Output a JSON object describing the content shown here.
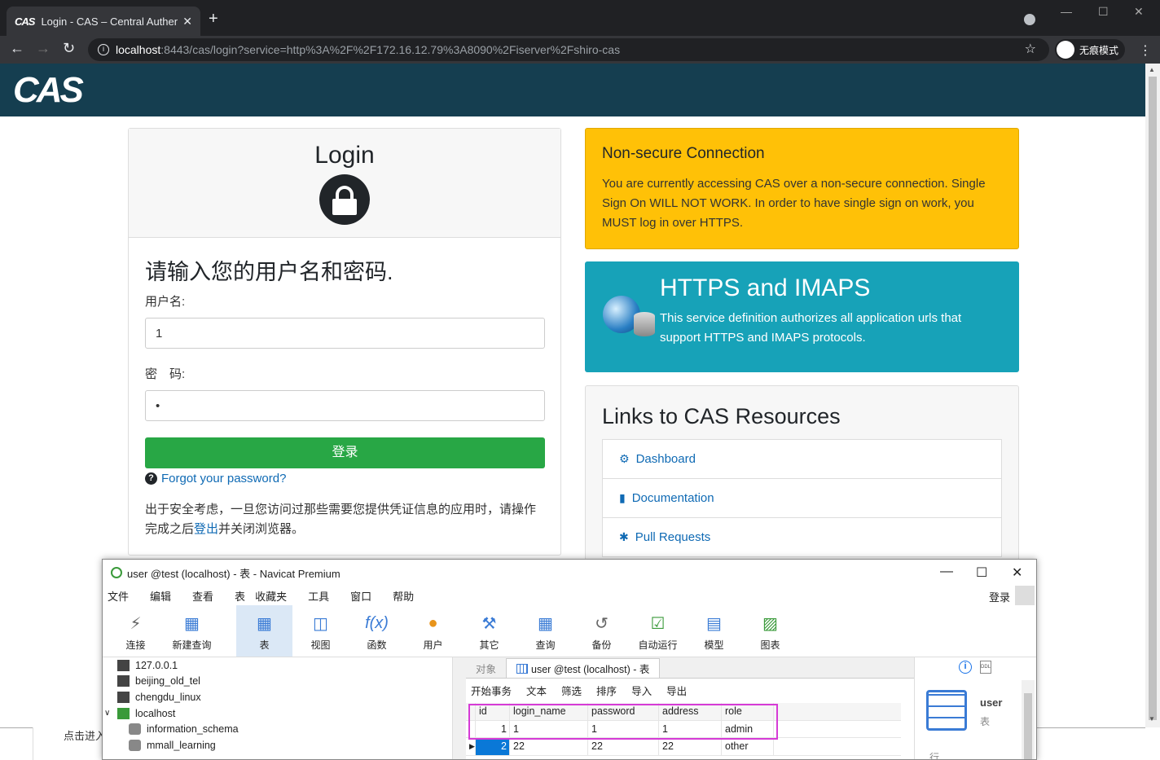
{
  "browser": {
    "tab_title": "Login - CAS – Central Authenti",
    "tab_favicon": "CAS",
    "url_host": "localhost",
    "url_rest": ":8443/cas/login?service=http%3A%2F%2F172.16.12.79%3A8090%2Fiserver%2Fshiro-cas",
    "incognito_label": "无痕模式"
  },
  "cas": {
    "logo": "CAS",
    "login": {
      "title": "Login",
      "heading": "请输入您的用户名和密码.",
      "username_label": "用户名:",
      "username_value": "1",
      "password_label": "密　码:",
      "password_value": "•",
      "submit_label": "登录",
      "forgot_label": "Forgot your password?",
      "notice_pre": "出于安全考虑，一旦您访问过那些需要您提供凭证信息的应用时，请操作完成之后",
      "notice_link": "登出",
      "notice_post": "并关闭浏览器。"
    },
    "warning": {
      "title": "Non-secure Connection",
      "body": "You are currently accessing CAS over a non-secure connection. Single Sign On WILL NOT WORK. In order to have single sign on work, you MUST log in over HTTPS."
    },
    "https_box": {
      "title": "HTTPS and IMAPS",
      "body": "This service definition authorizes all application urls that support HTTPS and IMAPS protocols."
    },
    "links": {
      "title": "Links to CAS Resources",
      "items": [
        {
          "label": "Dashboard",
          "icon": "cogs-icon"
        },
        {
          "label": "Documentation",
          "icon": "file-icon"
        },
        {
          "label": "Pull Requests",
          "icon": "bug-icon"
        }
      ]
    },
    "below_text": "点击进入"
  },
  "navicat": {
    "title": "user @test (localhost) - 表 - Navicat Premium",
    "menu": [
      "文件",
      "编辑",
      "查看",
      "表",
      "收藏夹",
      "工具",
      "窗口",
      "帮助"
    ],
    "login_label": "登录",
    "toolbar": [
      {
        "label": "连接",
        "icon": "plug-icon"
      },
      {
        "label": "新建查询",
        "icon": "new-query-icon"
      },
      {
        "label": "表",
        "icon": "table-icon"
      },
      {
        "label": "视图",
        "icon": "view-icon"
      },
      {
        "label": "函数",
        "icon": "function-icon"
      },
      {
        "label": "用户",
        "icon": "user-icon"
      },
      {
        "label": "其它",
        "icon": "tools-icon"
      },
      {
        "label": "查询",
        "icon": "query-icon"
      },
      {
        "label": "备份",
        "icon": "backup-icon"
      },
      {
        "label": "自动运行",
        "icon": "schedule-icon"
      },
      {
        "label": "模型",
        "icon": "model-icon"
      },
      {
        "label": "图表",
        "icon": "chart-icon"
      }
    ],
    "tree": [
      "127.0.0.1",
      "beijing_old_tel",
      "chengdu_linux",
      "localhost",
      "information_schema",
      "mmall_learning"
    ],
    "tabs": {
      "objects": "对象",
      "active": "user @test (localhost) - 表"
    },
    "subtoolbar": [
      "开始事务",
      "文本",
      "筛选",
      "排序",
      "导入",
      "导出"
    ],
    "grid": {
      "columns": [
        "id",
        "login_name",
        "password",
        "address",
        "role"
      ],
      "rows": [
        {
          "rownum": "1",
          "id": "1",
          "login_name": "1",
          "password": "1",
          "address": "1",
          "role": "admin"
        },
        {
          "rownum": "2",
          "id": "22",
          "login_name": "22",
          "password": "22",
          "address": "22",
          "role": "other"
        }
      ]
    },
    "side": {
      "name": "user",
      "type": "表",
      "rows_label": "行"
    }
  }
}
